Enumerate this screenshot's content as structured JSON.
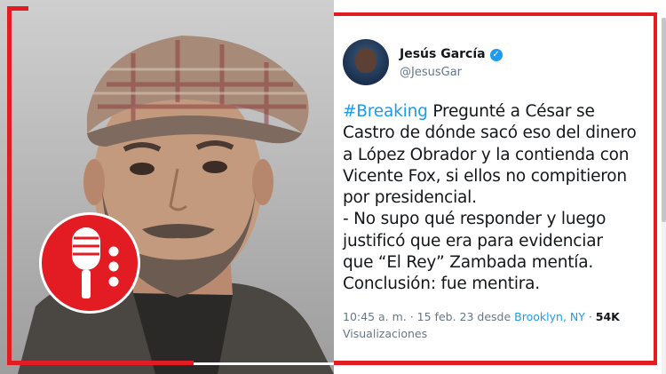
{
  "tweet": {
    "display_name": "Jesús García",
    "handle": "@JesusGar",
    "hashtag": "#Breaking",
    "body": " Pregunté a César se\nCastro de dónde sacó eso del dinero\na López Obrador y la contienda con\nVicente Fox, si ellos no compitieron\npor presidencial.\n- No supo qué responder y luego\njustificó que era para evidenciar\nque “El Rey” Zambada mentía.\nConclusión: fue mentira.",
    "time": "10:45 a. m. · 15 feb. 23 desde ",
    "location": "Brooklyn, NY",
    "separator": " · ",
    "views_count": "54K",
    "views_label": "Visualizaciones"
  },
  "icons": {
    "mic": "microphone-icon",
    "verified": "verified-badge-icon"
  },
  "colors": {
    "frame_red": "#e31b23",
    "link_blue": "#1d9bf0",
    "muted_gray": "#657786"
  }
}
